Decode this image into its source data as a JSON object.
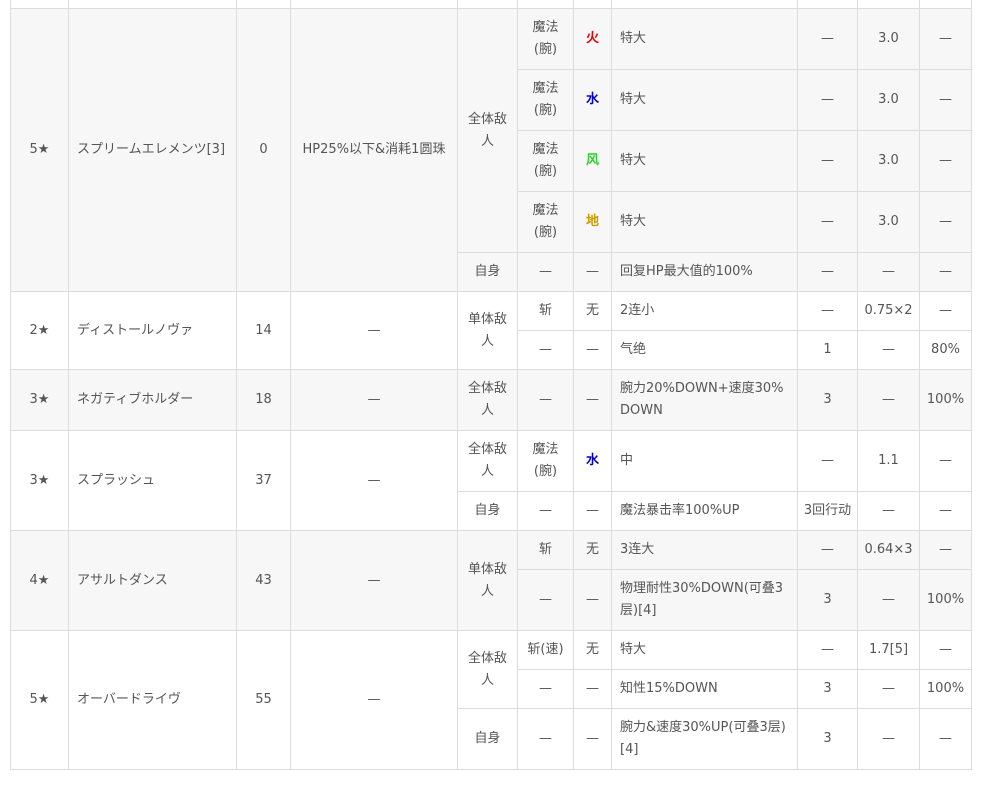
{
  "element_colors": {
    "火": "#e60000",
    "水": "#0000cc",
    "风": "#33cc33",
    "地": "#cc9900",
    "无": "#555555"
  },
  "skills": [
    {
      "rarity": "5★",
      "name": "スプリームエレメンツ[3]",
      "number": "0",
      "condition": "HP25%以下&消耗1圆珠",
      "targets": [
        {
          "target": "全体敌人",
          "rows": [
            {
              "type": "魔法(腕)",
              "element": "火",
              "effect": "特大",
              "c1": "—",
              "mult": "3.0",
              "rate": "—"
            },
            {
              "type": "魔法(腕)",
              "element": "水",
              "effect": "特大",
              "c1": "—",
              "mult": "3.0",
              "rate": "—"
            },
            {
              "type": "魔法(腕)",
              "element": "风",
              "effect": "特大",
              "c1": "—",
              "mult": "3.0",
              "rate": "—"
            },
            {
              "type": "魔法(腕)",
              "element": "地",
              "effect": "特大",
              "c1": "—",
              "mult": "3.0",
              "rate": "—"
            }
          ]
        },
        {
          "target": "自身",
          "rows": [
            {
              "type": "—",
              "element": "—",
              "effect": "回复HP最大值的100%",
              "c1": "—",
              "mult": "—",
              "rate": "—"
            }
          ]
        }
      ]
    },
    {
      "rarity": "2★",
      "name": "ディストールノヴァ",
      "number": "14",
      "condition": "—",
      "targets": [
        {
          "target": "单体敌人",
          "rows": [
            {
              "type": "斩",
              "element": "无",
              "effect": "2连小",
              "c1": "—",
              "mult": "0.75×2",
              "rate": "—"
            },
            {
              "type": "—",
              "element": "—",
              "effect": "气绝",
              "c1": "1",
              "mult": "—",
              "rate": "80%"
            }
          ]
        }
      ]
    },
    {
      "rarity": "3★",
      "name": "ネガティブホルダー",
      "number": "18",
      "condition": "—",
      "targets": [
        {
          "target": "全体敌人",
          "rows": [
            {
              "type": "—",
              "element": "—",
              "effect": "腕力20%DOWN+速度30%DOWN",
              "c1": "3",
              "mult": "—",
              "rate": "100%"
            }
          ]
        }
      ]
    },
    {
      "rarity": "3★",
      "name": "スプラッシュ",
      "number": "37",
      "condition": "—",
      "targets": [
        {
          "target": "全体敌人",
          "rows": [
            {
              "type": "魔法(腕)",
              "element": "水",
              "effect": "中",
              "c1": "—",
              "mult": "1.1",
              "rate": "—"
            }
          ]
        },
        {
          "target": "自身",
          "rows": [
            {
              "type": "—",
              "element": "—",
              "effect": "魔法暴击率100%UP",
              "c1": "3回行动",
              "mult": "—",
              "rate": "—"
            }
          ]
        }
      ]
    },
    {
      "rarity": "4★",
      "name": "アサルトダンス",
      "number": "43",
      "condition": "—",
      "targets": [
        {
          "target": "单体敌人",
          "rows": [
            {
              "type": "斩",
              "element": "无",
              "effect": "3连大",
              "c1": "—",
              "mult": "0.64×3",
              "rate": "—"
            },
            {
              "type": "—",
              "element": "—",
              "effect": "物理耐性30%DOWN(可叠3层)[4]",
              "c1": "3",
              "mult": "—",
              "rate": "100%"
            }
          ]
        }
      ]
    },
    {
      "rarity": "5★",
      "name": "オーバードライヴ",
      "number": "55",
      "condition": "—",
      "targets": [
        {
          "target": "全体敌人",
          "rows": [
            {
              "type": "斩(速)",
              "element": "无",
              "effect": "特大",
              "c1": "—",
              "mult": "1.7[5]",
              "rate": "—"
            },
            {
              "type": "—",
              "element": "—",
              "effect": "知性15%DOWN",
              "c1": "3",
              "mult": "—",
              "rate": "100%"
            }
          ]
        },
        {
          "target": "自身",
          "rows": [
            {
              "type": "—",
              "element": "—",
              "effect": "腕力&速度30%UP(可叠3层)[4]",
              "c1": "3",
              "mult": "—",
              "rate": "—"
            }
          ]
        }
      ]
    }
  ]
}
